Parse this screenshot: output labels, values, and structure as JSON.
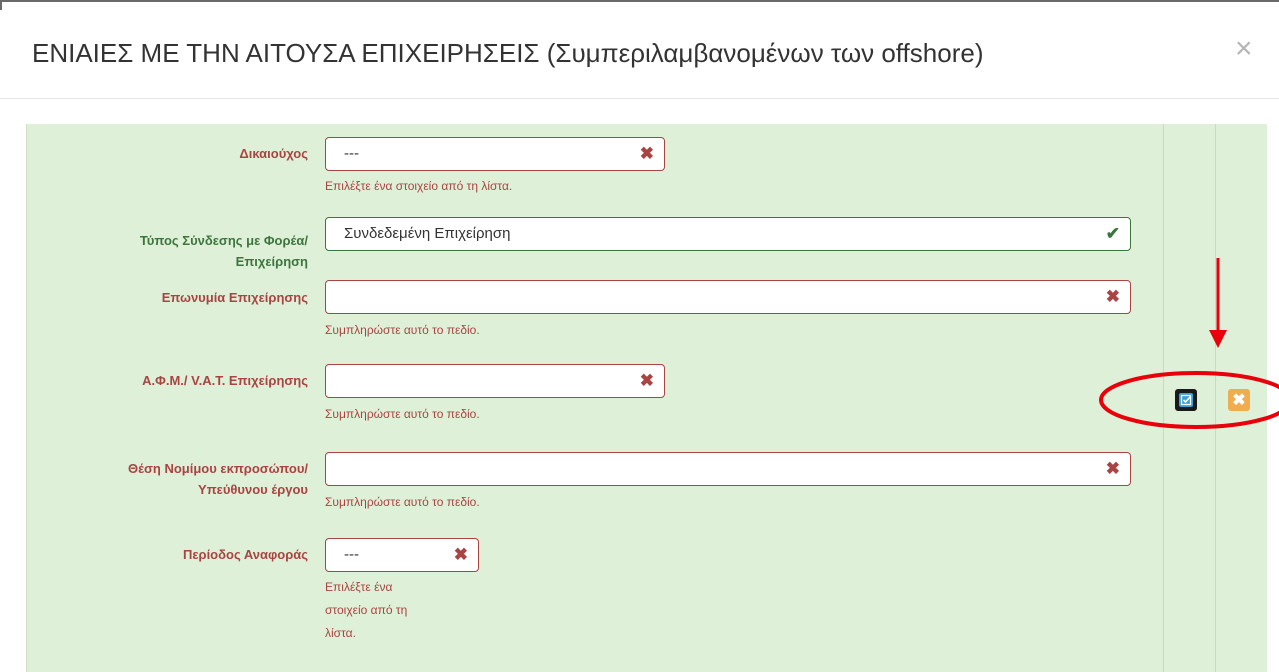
{
  "modal": {
    "title": "ΕΝΙΑΙΕΣ ΜΕ ΤΗΝ ΑΙΤΟΥΣΑ ΕΠΙΧΕΙΡΗΣΕΙΣ (Συμπεριλαμβανομένων των offshore)",
    "close_symbol": "×"
  },
  "form": {
    "beneficiary": {
      "label": "Δικαιούχος",
      "value": "---",
      "status": "error",
      "help": "Επιλέξτε ένα στοιχείο από τη λίστα."
    },
    "link_type": {
      "label_line1": "Τύπος Σύνδεσης με Φορέα/",
      "label_line2": "Επιχείρηση",
      "value": "Συνδεδεμένη Επιχείρηση",
      "status": "valid"
    },
    "company_name": {
      "label": "Επωνυμία Επιχείρησης",
      "value": "",
      "status": "error",
      "help": "Συμπληρώστε αυτό το πεδίο."
    },
    "vat": {
      "label": "Α.Φ.Μ./ V.A.T. Επιχείρησης",
      "value": "",
      "status": "error",
      "help": "Συμπληρώστε αυτό το πεδίο."
    },
    "representative_position": {
      "label_line1": "Θέση Νομίμου εκπροσώπου/",
      "label_line2": "Υπεύθυνου έργου",
      "value": "",
      "status": "error",
      "help": "Συμπληρώστε αυτό το πεδίο."
    },
    "reporting_period": {
      "label": "Περίοδος Αναφοράς",
      "value": "---",
      "status": "error",
      "help_line1": "Επιλέξτε ένα",
      "help_line2": "στοιχείο από τη",
      "help_line3": "λίστα."
    }
  },
  "icons": {
    "error": "✖",
    "valid": "✔",
    "cancel": "✖"
  },
  "colors": {
    "panel_bg": "#dff0d8",
    "error": "#a94442",
    "valid": "#3c763d",
    "edit_button": "#39a0d8",
    "cancel_button": "#f0ad4e",
    "annotation": "#e8000b"
  }
}
